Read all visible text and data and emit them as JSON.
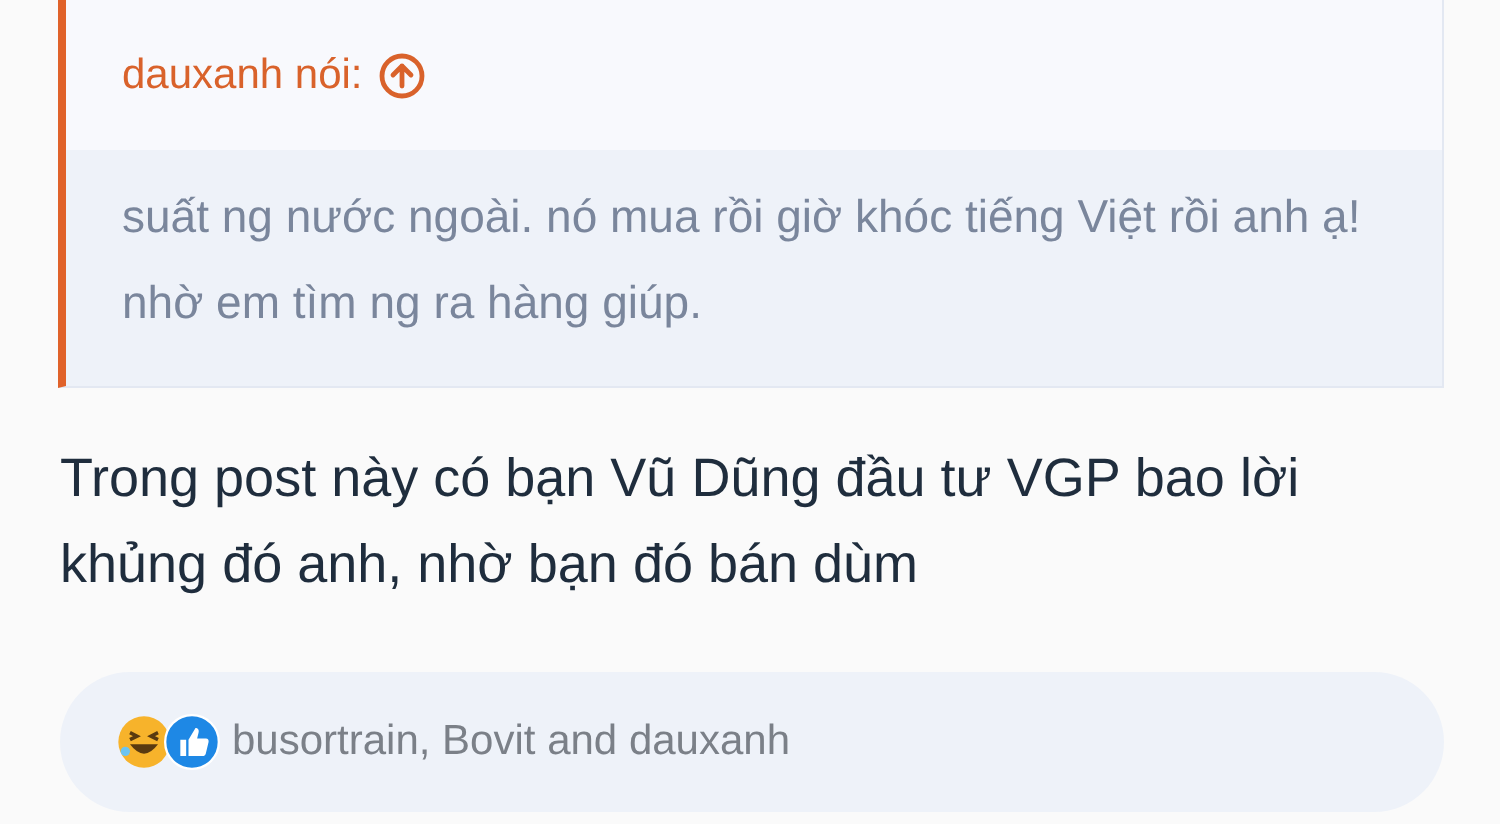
{
  "quote": {
    "author": "dauxanh nói:",
    "text": "suất ng nước ngoài. nó mua rồi giờ khóc tiếng Việt rồi anh ạ! nhờ em tìm ng ra hàng giúp."
  },
  "post": {
    "text": "Trong post này có bạn Vũ Dũng đầu tư VGP bao lời khủng đó anh, nhờ bạn đó bán dùm"
  },
  "reactions": {
    "icons": [
      {
        "kind": "laugh"
      },
      {
        "kind": "like"
      }
    ],
    "users": "busortrain, Bovit and dauxanh"
  }
}
